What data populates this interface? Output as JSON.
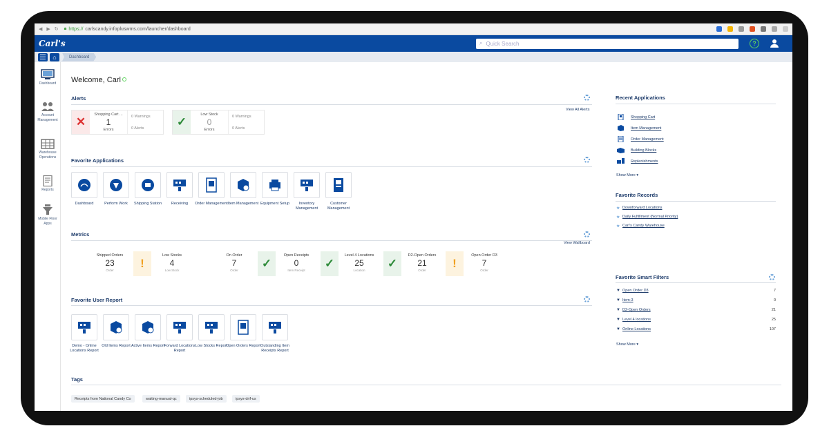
{
  "browser": {
    "url_scheme": "https://",
    "url_rest": "carlscandy.infopluswms.com/launcher/dashboard"
  },
  "header": {
    "logo": "Carl's",
    "search_placeholder": "Quick Search",
    "help_glyph": "?"
  },
  "breadcrumb": {
    "current": "Dashboard"
  },
  "left_nav": [
    {
      "label": "Dashboard",
      "icon": "monitor-icon"
    },
    {
      "label": "Account Management",
      "icon": "users-icon"
    },
    {
      "label": "Warehouse Operations",
      "icon": "warehouse-icon"
    },
    {
      "label": "Reports",
      "icon": "report-icon"
    },
    {
      "label": "Mobile Floor Apps",
      "icon": "mobile-icon"
    }
  ],
  "welcome": "Welcome, Carl",
  "alerts": {
    "title": "Alerts",
    "view_all": "View All Alerts",
    "cards": [
      {
        "name": "Shopping Cart ...",
        "count": "1",
        "count_label": "Errors",
        "warnings": "0 Warnings",
        "alerts": "0 Alerts",
        "status": "error"
      },
      {
        "name": "Low Stock",
        "count": "0",
        "count_label": "Errors",
        "warnings": "0 Warnings",
        "alerts": "0 Alerts",
        "status": "ok"
      }
    ]
  },
  "favorite_apps": {
    "title": "Favorite Applications",
    "items": [
      "Dashboard",
      "Perform Work",
      "Shipping Station",
      "Receiving",
      "Order Management",
      "Item Management",
      "Equipment Setup",
      "Inventory Management",
      "Customer Management"
    ]
  },
  "metrics": {
    "title": "Metrics",
    "view_wallboard": "View Wallboard",
    "items": [
      {
        "label": "Shipped Orders",
        "value": "23",
        "unit": "Order",
        "flag": "none"
      },
      {
        "label": "Low Stocks",
        "value": "4",
        "unit": "Low Stock",
        "flag": "warn"
      },
      {
        "label": "On Order",
        "value": "7",
        "unit": "Order",
        "flag": "none"
      },
      {
        "label": "Open Receipts",
        "value": "0",
        "unit": "Item Receipt",
        "flag": "ok"
      },
      {
        "label": "Level 4 Locations",
        "value": "25",
        "unit": "Location",
        "flag": "ok"
      },
      {
        "label": "D2-Open Orders",
        "value": "21",
        "unit": "Order",
        "flag": "ok"
      },
      {
        "label": "Open Order D3",
        "value": "7",
        "unit": "Order",
        "flag": "warn"
      }
    ]
  },
  "user_reports": {
    "title": "Favorite User Report",
    "items": [
      "Demo - Online Locations Report",
      "Old Items Report",
      "Active Items Report",
      "Forward Locations Report",
      "Low Stocks Report",
      "Open Orders Report",
      "Outstanding Item Receipts Report"
    ]
  },
  "tags": {
    "title": "Tags",
    "items": [
      "Receipts from National Candy Co",
      "waiting-manual-qc",
      "ipsys-scheduled-job",
      "ipsys-drif-us"
    ]
  },
  "recent_apps": {
    "title": "Recent Applications",
    "items": [
      "Shopping Cart",
      "Item Management",
      "Order Management",
      "Building Blocks",
      "Replenishments"
    ],
    "show_more": "Show More"
  },
  "favorite_records": {
    "title": "Favorite Records",
    "items": [
      "Downforward Locations",
      "Daily Fulfillment (Normal Priority)",
      "Carl's Candy Warehouse"
    ]
  },
  "smart_filters": {
    "title": "Favorite Smart Filters",
    "items": [
      {
        "label": "Open Order D3",
        "count": "7"
      },
      {
        "label": "Item-3",
        "count": "0"
      },
      {
        "label": "D2-Open Orders",
        "count": "21"
      },
      {
        "label": "Level 4 locations",
        "count": "25"
      },
      {
        "label": "Online Locations",
        "count": "107"
      }
    ],
    "show_more": "Show More"
  },
  "colors": {
    "brand": "#0a4aa0",
    "ok": "#2e8b3a",
    "error": "#d33",
    "warn": "#f0a020"
  }
}
